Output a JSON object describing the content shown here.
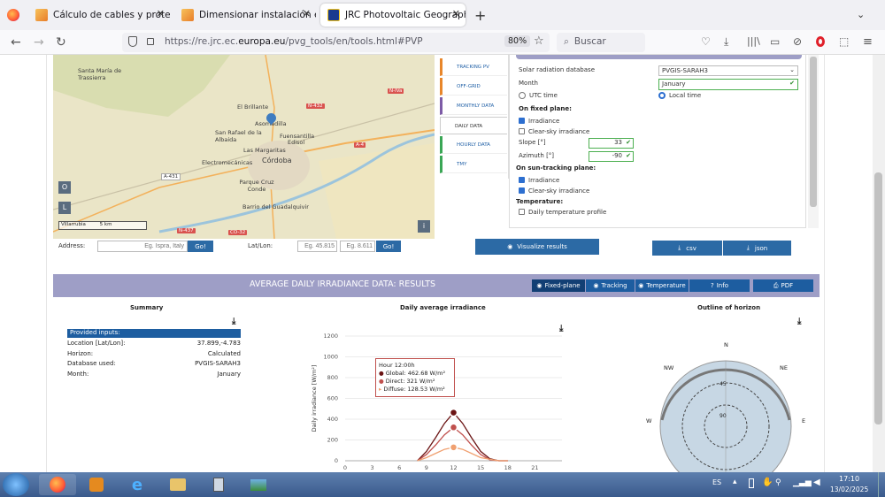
{
  "browser": {
    "tabs": [
      {
        "title": "Cálculo de cables y proteccione"
      },
      {
        "title": "Dimensionar instalación este oe"
      },
      {
        "title": "JRC Photovoltaic Geographical"
      }
    ],
    "url_prefix": "https://re.jrc.ec.",
    "url_domain": "europa.eu",
    "url_path": "/pvg_tools/en/tools.html#PVP",
    "zoom": "80%",
    "search_placeholder": "Buscar"
  },
  "map": {
    "labels": [
      "Santa María de Trassierra",
      "El Brillante",
      "San Rafael de la Albaida",
      "Asomadilla",
      "Fuensantilla",
      "Edisol",
      "Las Margaritas",
      "Electromecánicas",
      "Córdoba",
      "Parque Cruz Conde",
      "Barrio del Guadalquivir",
      "Villarrubia"
    ],
    "roads": [
      "N-IVa",
      "N-432",
      "A-4",
      "A-431",
      "N-437",
      "CO-32",
      "A-45"
    ],
    "zoom_o": "O",
    "zoom_l": "L",
    "info": "i",
    "scale": "5 km",
    "address_label": "Address:",
    "address_placeholder": "Eg. Ispra, Italy",
    "go": "Go!",
    "latlon_label": "Lat/Lon:",
    "lat_placeholder": "Eg. 45.815",
    "lon_placeholder": "Eg. 8.611"
  },
  "vtabs": [
    "TRACKING PV",
    "OFF-GRID",
    "MONTHLY DATA",
    "DAILY DATA",
    "HOURLY DATA",
    "TMY"
  ],
  "vtab_colors": [
    "#e8862a",
    "#e8862a",
    "#7d5ba6",
    "#ffffff",
    "#3aa655",
    "#3aa655"
  ],
  "form": {
    "db_label": "Solar radiation database",
    "db_value": "PVGIS-SARAH3",
    "month_label": "Month",
    "month_value": "January",
    "utc": "UTC time",
    "local": "Local time",
    "fixed_header": "On fixed plane:",
    "irr": "Irradiance",
    "clear": "Clear-sky irradiance",
    "slope_label": "Slope [°]",
    "slope_value": "33",
    "azimuth_label": "Azimuth [°]",
    "azimuth_value": "-90",
    "tracking_header": "On sun-tracking plane:",
    "t_irr": "Irradiance",
    "t_clear": "Clear-sky irradiance",
    "temp_header": "Temperature:",
    "temp_profile": "Daily temperature profile",
    "visualize": "Visualize results",
    "csv": "csv",
    "json": "json"
  },
  "results": {
    "header": "AVERAGE DAILY IRRADIANCE DATA: RESULTS",
    "buttons": [
      "Fixed-plane",
      "Tracking",
      "Temperature",
      "Info",
      "PDF"
    ],
    "summary_title": "Summary",
    "inputs_header": "Provided inputs:",
    "rows": [
      {
        "k": "Location [Lat/Lon]:",
        "v": "37.899,-4.783"
      },
      {
        "k": "Horizon:",
        "v": "Calculated"
      },
      {
        "k": "Database used:",
        "v": "PVGIS-SARAH3"
      },
      {
        "k": "Month:",
        "v": "January"
      }
    ],
    "chart_title": "Daily average irradiance",
    "horizon_title": "Outline of horizon",
    "tooltip": {
      "hour": "Hour 12:00h",
      "global": "Global: 462.68 W/m²",
      "direct": "Direct: 321 W/m²",
      "diffuse": "Diffuse: 128.53 W/m²"
    },
    "compass": {
      "n": "N",
      "ne": "NE",
      "nw": "NW",
      "e": "E",
      "w": "W",
      "r45": "45",
      "r90": "90"
    }
  },
  "chart_data": {
    "type": "line",
    "ylabel": "Daily irradiance [W/m²]",
    "xlim": [
      0,
      24
    ],
    "ylim": [
      0,
      1200
    ],
    "xticks": [
      0,
      3,
      6,
      9,
      12,
      15,
      18,
      21
    ],
    "yticks": [
      0,
      200,
      400,
      600,
      800,
      1000,
      1200
    ],
    "x": [
      8,
      9,
      10,
      11,
      12,
      13,
      14,
      15,
      16,
      17,
      18
    ],
    "series": [
      {
        "name": "Global",
        "color": "#6b1414",
        "values": [
          0,
          90,
          220,
          360,
          463,
          360,
          220,
          90,
          20,
          0,
          0
        ]
      },
      {
        "name": "Direct",
        "color": "#c0504d",
        "values": [
          0,
          60,
          150,
          250,
          321,
          250,
          150,
          60,
          10,
          0,
          0
        ]
      },
      {
        "name": "Diffuse",
        "color": "#f0a070",
        "values": [
          0,
          30,
          70,
          110,
          129,
          110,
          70,
          30,
          15,
          0,
          0
        ]
      }
    ]
  },
  "taskbar": {
    "lang": "ES",
    "time": "17:10",
    "date": "13/02/2025"
  }
}
